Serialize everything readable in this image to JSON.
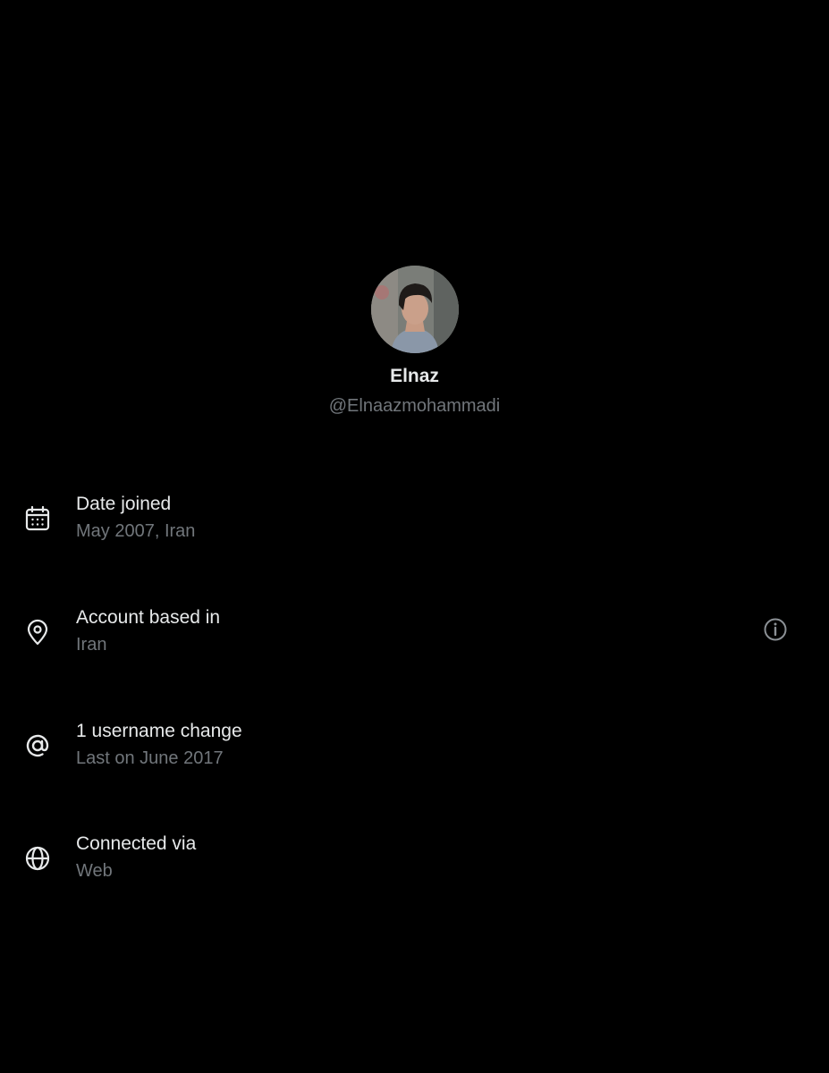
{
  "profile": {
    "display_name": "Elnaz",
    "handle": "@Elnaazmohammadi"
  },
  "rows": [
    {
      "icon": "calendar-icon",
      "title": "Date joined",
      "subtitle": "May 2007, Iran"
    },
    {
      "icon": "location-pin-icon",
      "title": "Account based in",
      "subtitle": "Iran"
    },
    {
      "icon": "at-sign-icon",
      "title": "1 username change",
      "subtitle": "Last on June 2017"
    },
    {
      "icon": "globe-icon",
      "title": "Connected via",
      "subtitle": "Web"
    }
  ],
  "info_button": {
    "icon": "info-icon"
  },
  "colors": {
    "background": "#000000",
    "primary_text": "#e7e9ea",
    "secondary_text": "#71767b"
  }
}
